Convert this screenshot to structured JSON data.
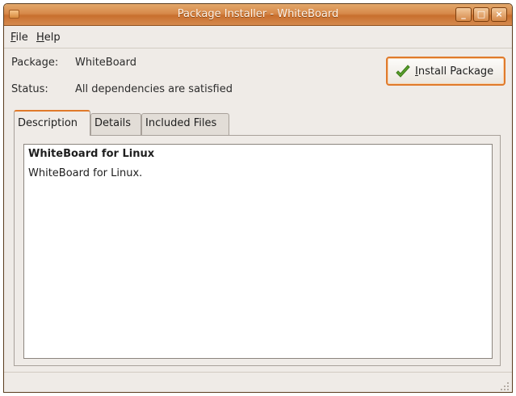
{
  "window": {
    "title": "Package Installer - WhiteBoard",
    "controls": {
      "minimize": "_",
      "maximize": "□",
      "close": "×"
    },
    "accent_color": "#d7894a"
  },
  "menu": {
    "file": {
      "mnemonic": "F",
      "rest": "ile"
    },
    "help": {
      "mnemonic": "H",
      "rest": "elp"
    }
  },
  "info": {
    "package_label": "Package:",
    "package_value": "WhiteBoard",
    "status_label": "Status:",
    "status_value": "All dependencies are satisfied"
  },
  "install_button": {
    "icon": "check-icon",
    "mnemonic": "I",
    "rest": "nstall Package"
  },
  "tabs": [
    {
      "label": "Description",
      "active": true
    },
    {
      "label": "Details",
      "active": false
    },
    {
      "label": "Included Files",
      "active": false
    }
  ],
  "description": {
    "title": "WhiteBoard for Linux",
    "body": "WhiteBoard for Linux."
  }
}
